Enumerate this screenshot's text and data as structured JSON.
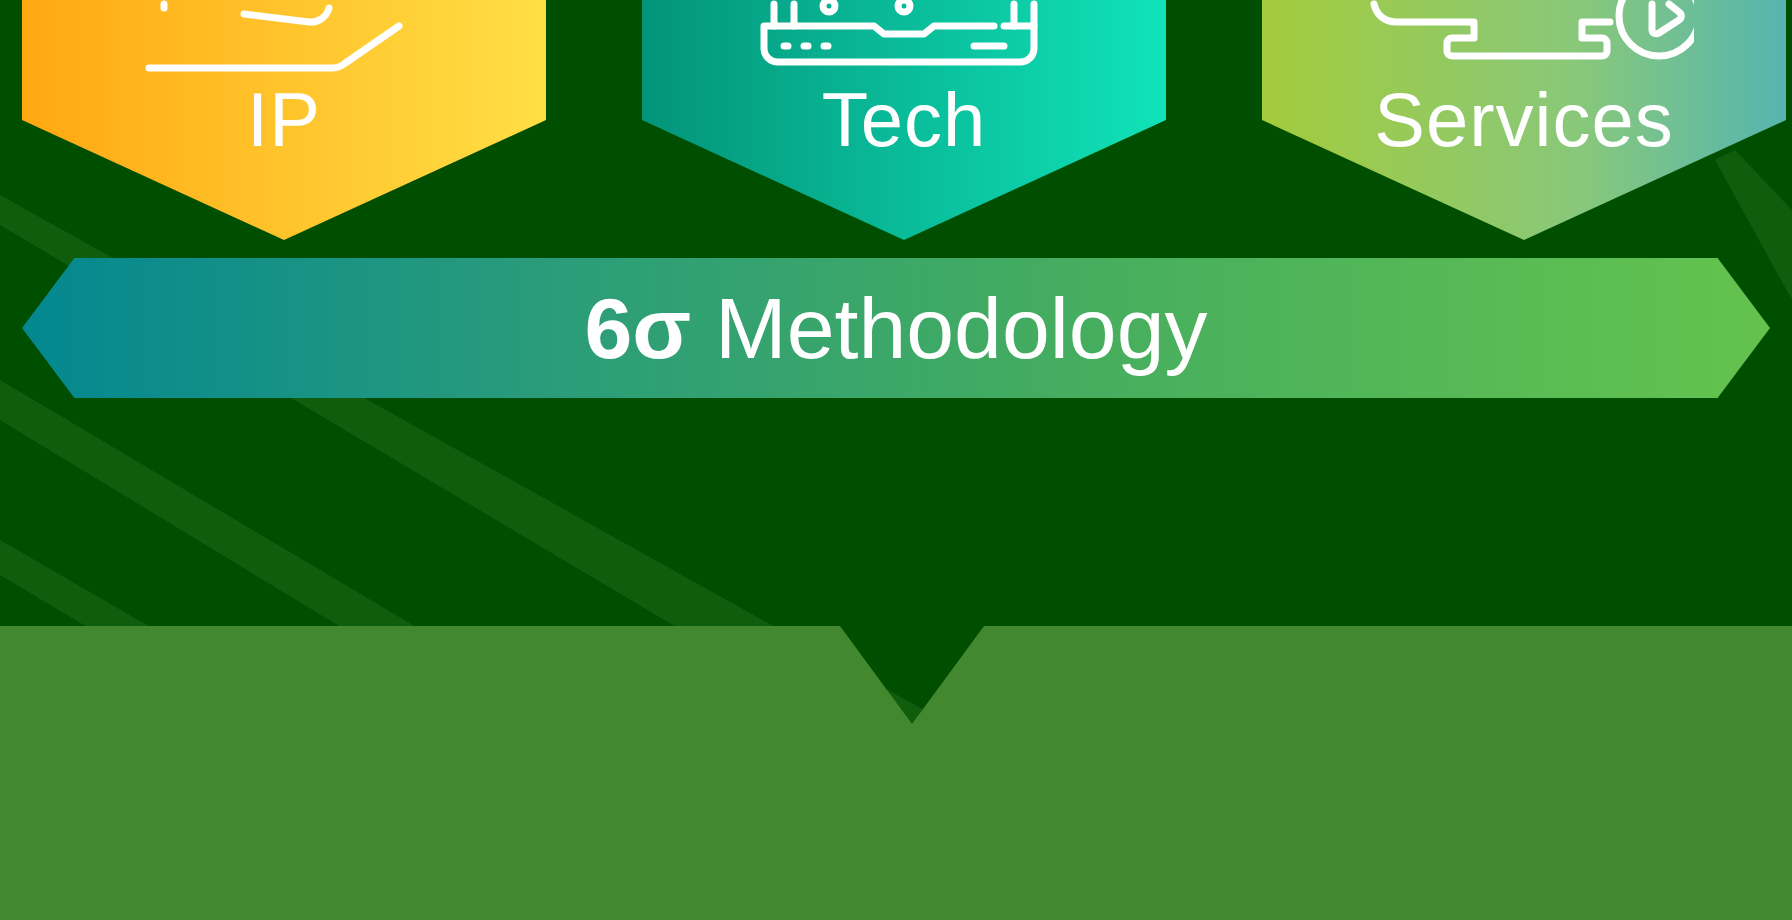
{
  "cards": [
    {
      "label": "IP",
      "kind": "ip"
    },
    {
      "label": "Tech",
      "kind": "tech"
    },
    {
      "label": "Services",
      "kind": "services"
    }
  ],
  "banner": {
    "text": "**6σ** Methodology"
  }
}
